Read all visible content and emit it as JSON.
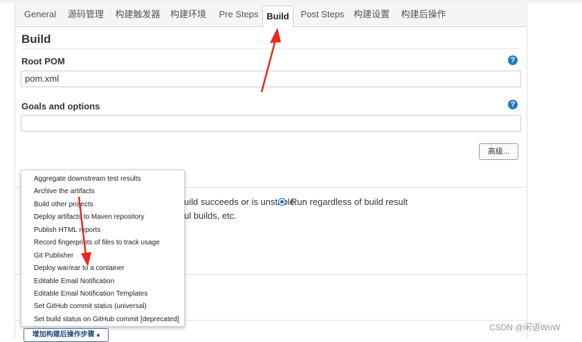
{
  "tabs": [
    {
      "label": "General",
      "active": false
    },
    {
      "label": "源码管理",
      "active": false
    },
    {
      "label": "构建触发器",
      "active": false
    },
    {
      "label": "构建环境",
      "active": false
    },
    {
      "label": "Pre Steps",
      "active": false
    },
    {
      "label": "Build",
      "active": true
    },
    {
      "label": "Post Steps",
      "active": false
    },
    {
      "label": "构建设置",
      "active": false
    },
    {
      "label": "构建后操作",
      "active": false
    }
  ],
  "build": {
    "title": "Build",
    "root_pom_label": "Root POM",
    "root_pom_value": "pom.xml",
    "goals_label": "Goals and options",
    "goals_value": "",
    "advanced_button": "高级...",
    "help_glyph": "?"
  },
  "post_steps_partial": {
    "radio_text_left": "uild succeeds or is unstable",
    "radio_text_right": "Run regardless of build result",
    "partial_text": "ul builds, etc."
  },
  "dropdown_menu": {
    "items": [
      "Aggregate downstream test results",
      "Archive the artifacts",
      "Build other projects",
      "Deploy artifacts to Maven repository",
      "Publish HTML reports",
      "Record fingerprints of files to track usage",
      "Git Publisher",
      "Deploy war/ear to a container",
      "Editable Email Notification",
      "Editable Email Notification Templates",
      "Set GitHub commit status (universal)",
      "Set build status on GitHub commit [deprecated]"
    ]
  },
  "add_post_build_button": "增加构建后操作步骤 ▴",
  "watermark": "CSDN @闲语WoW",
  "colors": {
    "accent_blue": "#1f7bc1",
    "annotation_red": "#e8281e"
  }
}
